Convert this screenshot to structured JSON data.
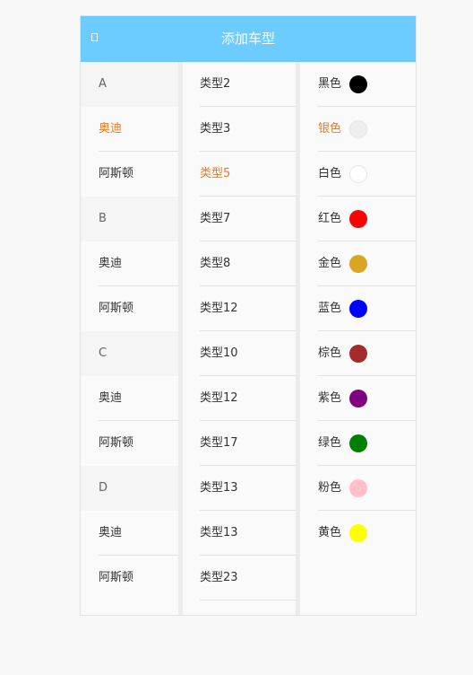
{
  "header": {
    "title": "添加车型",
    "back_icon": "back-icon"
  },
  "brands": [
    {
      "type": "letter",
      "label": "A"
    },
    {
      "type": "item",
      "label": "奥迪",
      "selected": true
    },
    {
      "type": "item",
      "label": "阿斯顿",
      "last": true
    },
    {
      "type": "letter",
      "label": "B"
    },
    {
      "type": "item",
      "label": "奥迪"
    },
    {
      "type": "item",
      "label": "阿斯顿",
      "last": true
    },
    {
      "type": "letter",
      "label": "C"
    },
    {
      "type": "item",
      "label": "奥迪"
    },
    {
      "type": "item",
      "label": "阿斯顿",
      "last": true
    },
    {
      "type": "letter",
      "label": "D"
    },
    {
      "type": "item",
      "label": "奥迪"
    },
    {
      "type": "item",
      "label": "阿斯顿",
      "last": true
    }
  ],
  "models": [
    {
      "label": "类型2"
    },
    {
      "label": "类型3"
    },
    {
      "label": "类型5",
      "selected": true
    },
    {
      "label": "类型7"
    },
    {
      "label": "类型8"
    },
    {
      "label": "类型12"
    },
    {
      "label": "类型10"
    },
    {
      "label": "类型12"
    },
    {
      "label": "类型17"
    },
    {
      "label": "类型13"
    },
    {
      "label": "类型13"
    },
    {
      "label": "类型23"
    }
  ],
  "colors": [
    {
      "label": "黑色",
      "color": "#000000"
    },
    {
      "label": "银色",
      "color": "#eeeeee",
      "selected": true
    },
    {
      "label": "白色",
      "color": "#ffffff"
    },
    {
      "label": "红色",
      "color": "#ff0000"
    },
    {
      "label": "金色",
      "color": "#daa520"
    },
    {
      "label": "蓝色",
      "color": "#0000ff"
    },
    {
      "label": "棕色",
      "color": "#a52a2a"
    },
    {
      "label": "紫色",
      "color": "#800080"
    },
    {
      "label": "绿色",
      "color": "#008000"
    },
    {
      "label": "粉色",
      "color": "#ffc0cb"
    },
    {
      "label": "黄色",
      "color": "#ffff00",
      "last": true
    }
  ],
  "theme": {
    "accent": "#ef7a22",
    "header_bg": "#6ccbff"
  }
}
